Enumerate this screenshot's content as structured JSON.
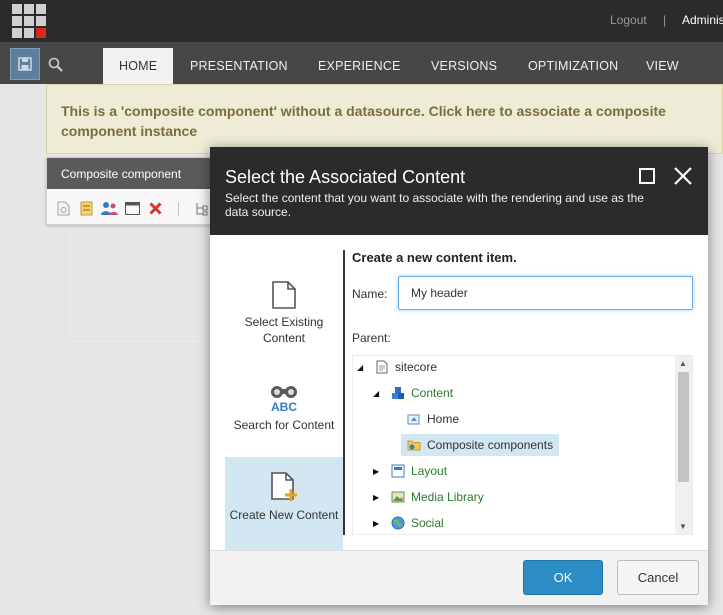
{
  "topbar": {
    "logout": "Logout",
    "separator": "|",
    "user": "Administrator"
  },
  "ribbon": {
    "tabs": [
      {
        "label": "HOME",
        "active": true
      },
      {
        "label": "PRESENTATION"
      },
      {
        "label": "EXPERIENCE"
      },
      {
        "label": "VERSIONS"
      },
      {
        "label": "OPTIMIZATION"
      },
      {
        "label": "VIEW"
      }
    ]
  },
  "banner": {
    "text": "This is a 'composite component' without a datasource. Click here to associate a composite component instance"
  },
  "component_bar": {
    "title": "Composite component"
  },
  "dialog": {
    "title": "Select the Associated Content",
    "subtitle": "Select the content that you want to associate with the rendering and use as the data source.",
    "side": {
      "existing": "Select Existing Content",
      "search": "Search for Content",
      "create": "Create New Content"
    },
    "pane": {
      "title": "Create a new content item.",
      "name_label": "Name:",
      "name_value": "My header",
      "parent_label": "Parent:"
    },
    "tree": [
      {
        "label": "sitecore",
        "expanded": true,
        "level": 0
      },
      {
        "label": "Content",
        "expanded": true,
        "level": 1
      },
      {
        "label": "Home",
        "level": 2
      },
      {
        "label": "Composite components",
        "level": 2,
        "selected": true
      },
      {
        "label": "Layout",
        "expanded": false,
        "level": 1
      },
      {
        "label": "Media Library",
        "expanded": false,
        "level": 1
      },
      {
        "label": "Social",
        "expanded": false,
        "level": 1
      }
    ],
    "ok_label": "OK",
    "cancel_label": "Cancel"
  },
  "colors": {
    "accent": "#2c8dc5",
    "banner_bg": "#eeebd6",
    "selection": "#d3e7f3",
    "brand_red": "#dc291e"
  }
}
